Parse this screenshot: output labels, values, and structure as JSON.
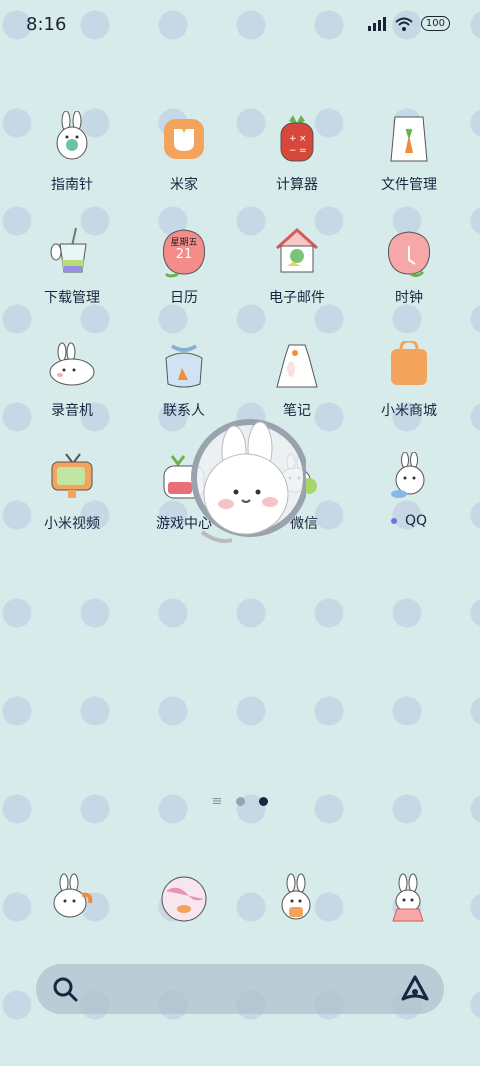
{
  "status": {
    "time": "8:16",
    "battery": "100"
  },
  "apps": [
    {
      "label": "指南针",
      "icon": "bunny-compass-icon"
    },
    {
      "label": "米家",
      "icon": "mijia-icon"
    },
    {
      "label": "计算器",
      "icon": "carrot-calculator-icon"
    },
    {
      "label": "文件管理",
      "icon": "carrot-file-icon"
    },
    {
      "label": "下载管理",
      "icon": "cup-download-icon"
    },
    {
      "label": "日历",
      "icon": "peach-calendar-icon",
      "calendar_day": "星期五",
      "calendar_date": "21"
    },
    {
      "label": "电子邮件",
      "icon": "house-mail-icon"
    },
    {
      "label": "时钟",
      "icon": "peach-clock-icon"
    },
    {
      "label": "录音机",
      "icon": "bunny-recorder-icon"
    },
    {
      "label": "联系人",
      "icon": "bag-contacts-icon"
    },
    {
      "label": "笔记",
      "icon": "dress-notes-icon"
    },
    {
      "label": "小米商城",
      "icon": "shopping-bag-icon"
    },
    {
      "label": "小米视频",
      "icon": "tv-video-icon"
    },
    {
      "label": "游戏中心",
      "icon": "game-center-icon"
    },
    {
      "label": "微信",
      "icon": "wechat-icon",
      "new": true
    },
    {
      "label": "QQ",
      "icon": "qq-icon",
      "new": true
    }
  ],
  "floating_widget": {
    "icon": "bunny-assistant-icon"
  },
  "pager": {
    "pages": 2,
    "active": 1
  },
  "dock": [
    {
      "icon": "bunny-phone-icon"
    },
    {
      "icon": "planet-browser-icon"
    },
    {
      "icon": "bunny-messages-icon"
    },
    {
      "icon": "bunny-camera-icon"
    }
  ],
  "search": {
    "icon": "search-icon",
    "assistant_icon": "xiaoai-icon"
  }
}
